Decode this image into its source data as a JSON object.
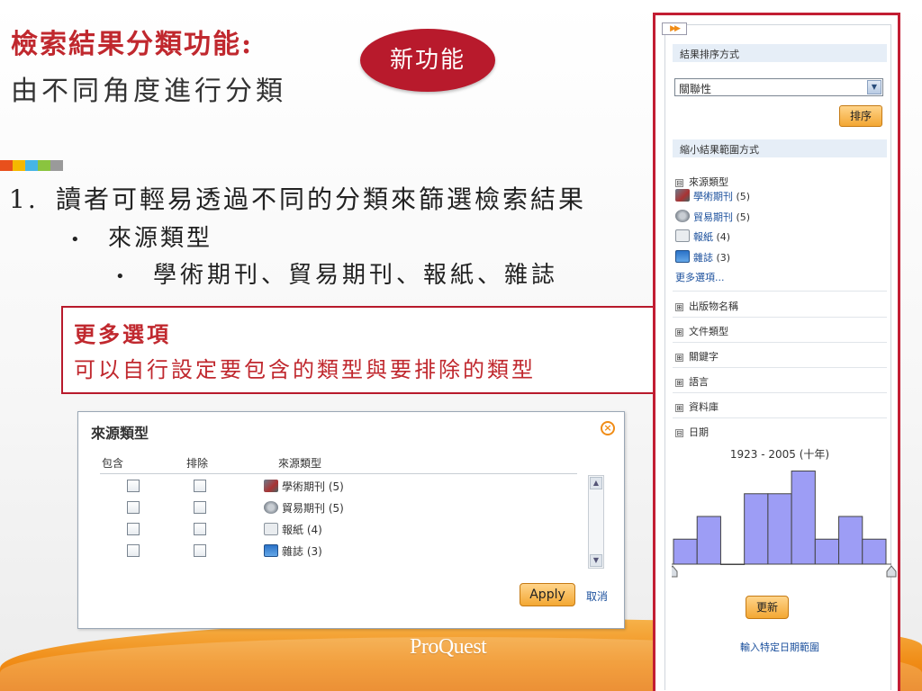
{
  "slide": {
    "title_bold": "檢索結果分類功能:",
    "title_sub": "由不同角度進行分類",
    "badge": "新功能",
    "color_bar": [
      "#e8501c",
      "#f5b800",
      "#46b5e6",
      "#8ac43f",
      "#9a9a9a"
    ],
    "bullet1_num": "1.",
    "bullet1_text": "讀者可輕易透過不同的分類來篩選檢索結果",
    "bullet2_dot": "•",
    "bullet2_text": "來源類型",
    "bullet3_dot": "•",
    "bullet3_text": "學術期刊、貿易期刊、報紙、雜誌",
    "callout_title": "更多選項",
    "callout_text": "可以自行設定要包含的類型與要排除的類型",
    "logo": "ProQuest"
  },
  "dialog": {
    "title": "來源類型",
    "close_glyph": "×",
    "col_include": "包含",
    "col_exclude": "排除",
    "col_source": "來源類型",
    "rows": [
      {
        "label": "學術期刊",
        "count": "(5)",
        "icon": "scholarly-journal-icon"
      },
      {
        "label": "貿易期刊",
        "count": "(5)",
        "icon": "trade-journal-icon"
      },
      {
        "label": "報紙",
        "count": "(4)",
        "icon": "newspaper-icon"
      },
      {
        "label": "雜誌",
        "count": "(3)",
        "icon": "magazine-icon"
      }
    ],
    "apply": "Apply",
    "cancel": "取消",
    "scroll_up": "▲",
    "scroll_down": "▼"
  },
  "panel": {
    "expander": "▶▶",
    "sort_header": "結果排序方式",
    "sort_value": "關聯性",
    "select_arrow": "▼",
    "sort_button": "排序",
    "narrow_header": "縮小結果範圍方式",
    "source_facet": "來源類型",
    "expanded_glyph": "⊟",
    "collapsed_glyph": "⊞",
    "source_items": [
      {
        "label": "學術期刊",
        "count": "(5)"
      },
      {
        "label": "貿易期刊",
        "count": "(5)"
      },
      {
        "label": "報紙",
        "count": "(4)"
      },
      {
        "label": "雜誌",
        "count": "(3)"
      }
    ],
    "more_options": "更多選項...",
    "facets": [
      "出版物名稱",
      "文件類型",
      "關鍵字",
      "語言",
      "資料庫"
    ],
    "date_facet": "日期",
    "date_range_label": "1923 - 2005 (十年)",
    "update_button": "更新",
    "specific_date_link": "輸入特定日期範圍",
    "histogram_color": "#9d9df5"
  },
  "chart_data": {
    "type": "bar",
    "title": "1923 - 2005 (十年)",
    "categories": [
      "1",
      "2",
      "3",
      "4",
      "5",
      "6",
      "7",
      "8",
      "9"
    ],
    "values": [
      1.1,
      2.1,
      0,
      3.1,
      3.1,
      4.1,
      1.1,
      2.1,
      1.1
    ],
    "ylim": [
      0,
      4.2
    ],
    "grid": false,
    "xlabel": "",
    "ylabel": ""
  }
}
